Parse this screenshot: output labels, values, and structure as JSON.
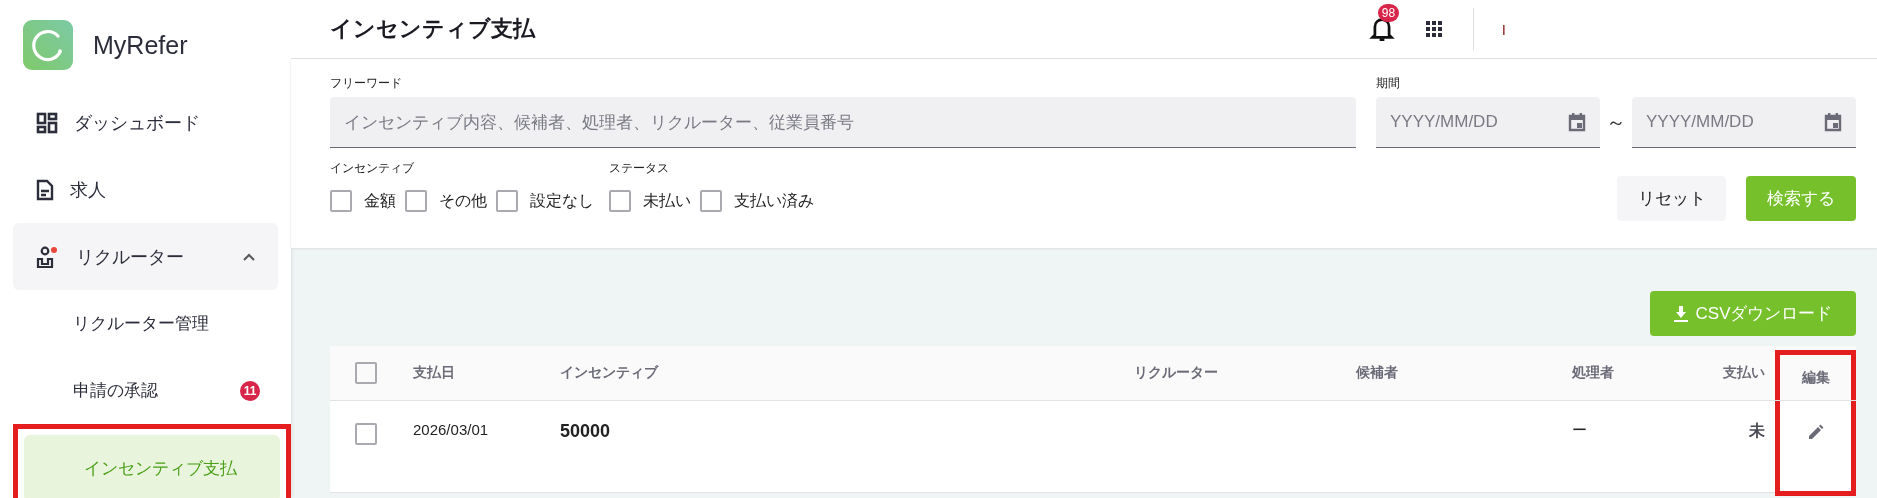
{
  "app": {
    "name": "MyRefer"
  },
  "sidebar": {
    "items": [
      {
        "label": "ダッシュボード",
        "selected": false
      },
      {
        "label": "求人",
        "selected": false
      },
      {
        "label": "リクルーター",
        "selected": false,
        "expanded": true,
        "children": [
          {
            "label": "リクルーター管理",
            "selected": false
          },
          {
            "label": "申請の承認",
            "selected": false,
            "badge": "11"
          },
          {
            "label": "インセンティブ支払",
            "selected": true,
            "highlighted": true
          }
        ]
      }
    ]
  },
  "header": {
    "title": "インセンティブ支払",
    "notification_count": "98",
    "user": "I"
  },
  "filters": {
    "freeword": {
      "label": "フリーワード",
      "placeholder": "インセンティブ内容、候補者、処理者、リクルーター、従業員番号"
    },
    "period": {
      "label": "期間",
      "from_placeholder": "YYYY/MM/DD",
      "separator": "～",
      "to_placeholder": "YYYY/MM/DD"
    },
    "groups": [
      {
        "label": "インセンティブ",
        "options": [
          {
            "label": "金額",
            "checked": false
          },
          {
            "label": "その他",
            "checked": false
          },
          {
            "label": "設定なし",
            "checked": false
          }
        ]
      },
      {
        "label": "ステータス",
        "options": [
          {
            "label": "未払い",
            "checked": false
          },
          {
            "label": "支払い済み",
            "checked": false
          }
        ]
      }
    ],
    "buttons": [
      {
        "label": "リセット",
        "kind": "secondary"
      },
      {
        "label": "検索する",
        "kind": "primary"
      }
    ]
  },
  "csv_button": "CSVダウンロード",
  "table": {
    "all_selected": false,
    "columns": [
      {
        "kind": "check",
        "highlighted": false
      },
      {
        "label": "支払日",
        "highlighted": false
      },
      {
        "label": "インセンティブ",
        "highlighted": false
      },
      {
        "label": "リクルーター",
        "highlighted": false
      },
      {
        "label": "候補者",
        "highlighted": false
      },
      {
        "label": "処理者",
        "highlighted": false
      },
      {
        "label": "支払い",
        "highlighted": false
      },
      {
        "label": "編集",
        "highlighted": true
      }
    ],
    "rows": [
      {
        "selected": false,
        "payment_date": "2026/03/01",
        "incentive": "50000",
        "handler": "ー",
        "paid": "未"
      }
    ]
  }
}
